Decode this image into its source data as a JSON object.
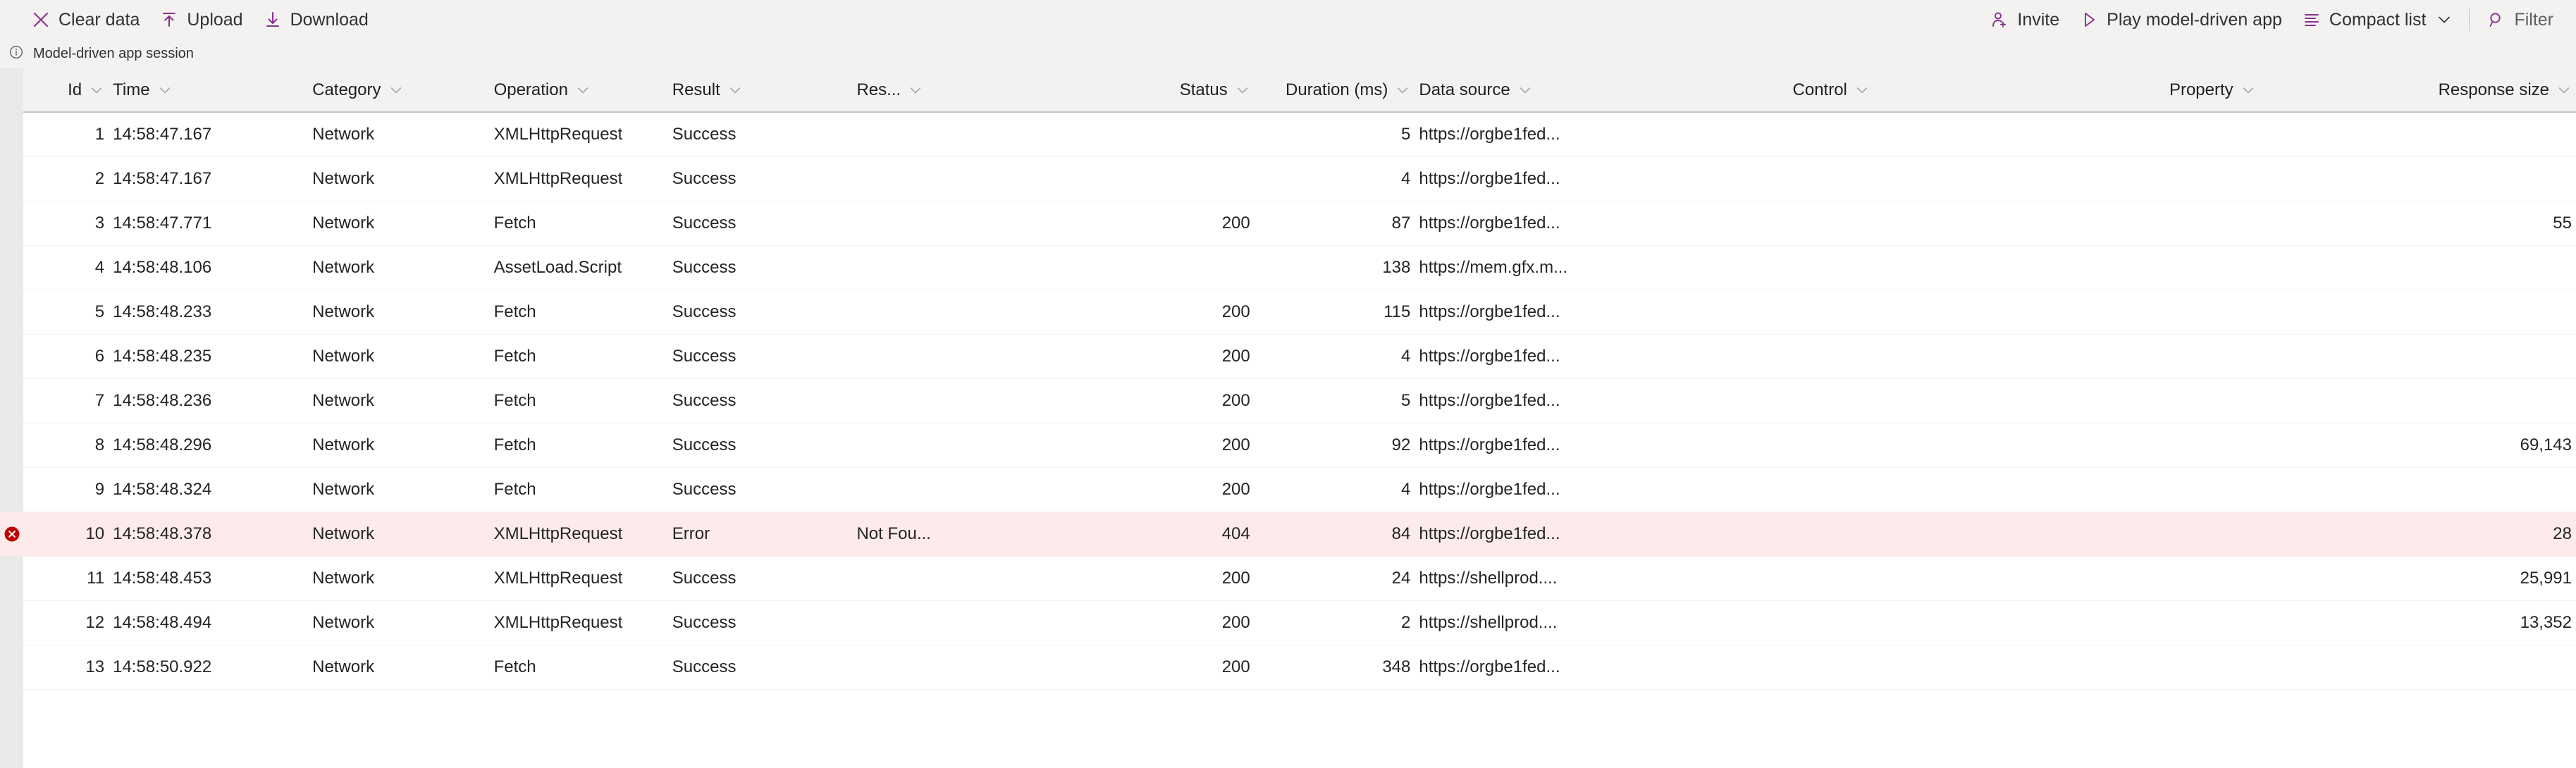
{
  "commandbar": {
    "left_items": [
      {
        "label": "Clear data",
        "icon": "clear-data-icon"
      },
      {
        "label": "Upload",
        "icon": "upload-icon"
      },
      {
        "label": "Download",
        "icon": "download-icon"
      }
    ],
    "right_items": [
      {
        "label": "Invite",
        "icon": "invite-person-add-icon"
      },
      {
        "label": "Play model-driven app",
        "icon": "play-triangle-icon"
      },
      {
        "label": "Compact list",
        "icon": "list-lines-icon",
        "chevron": "∨"
      },
      {
        "label": "Filter",
        "icon": "filter-search-icon"
      }
    ],
    "accent_color": "#8a2f8f"
  },
  "session": {
    "icon": "info-circle-icon",
    "label": "Model-driven app session"
  },
  "grid": {
    "sort_glyph": "∨",
    "columns": [
      {
        "key": "id",
        "label": "Id",
        "align": "right"
      },
      {
        "key": "time",
        "label": "Time",
        "align": "left"
      },
      {
        "key": "category",
        "label": "Category",
        "align": "left"
      },
      {
        "key": "operation",
        "label": "Operation",
        "align": "left"
      },
      {
        "key": "result",
        "label": "Result",
        "align": "left"
      },
      {
        "key": "res",
        "label": "Res...",
        "align": "left"
      },
      {
        "key": "status",
        "label": "Status",
        "align": "right"
      },
      {
        "key": "duration",
        "label": "Duration (ms)",
        "align": "right"
      },
      {
        "key": "source",
        "label": "Data source",
        "align": "left"
      },
      {
        "key": "control",
        "label": "Control",
        "align": "left"
      },
      {
        "key": "property",
        "label": "Property",
        "align": "left"
      },
      {
        "key": "respsize",
        "label": "Response size",
        "align": "right"
      }
    ],
    "error_icon": "error-circle-x-icon",
    "error_row_color": "#fdeaea",
    "rows": [
      {
        "id": "1",
        "time": "14:58:47.167",
        "category": "Network",
        "operation": "XMLHttpRequest",
        "result": "Success",
        "res": "",
        "status": "",
        "duration": "5",
        "source": "https://orgbe1fed...",
        "control": "",
        "property": "",
        "respsize": "",
        "error": false
      },
      {
        "id": "2",
        "time": "14:58:47.167",
        "category": "Network",
        "operation": "XMLHttpRequest",
        "result": "Success",
        "res": "",
        "status": "",
        "duration": "4",
        "source": "https://orgbe1fed...",
        "control": "",
        "property": "",
        "respsize": "",
        "error": false
      },
      {
        "id": "3",
        "time": "14:58:47.771",
        "category": "Network",
        "operation": "Fetch",
        "result": "Success",
        "res": "",
        "status": "200",
        "duration": "87",
        "source": "https://orgbe1fed...",
        "control": "",
        "property": "",
        "respsize": "55",
        "error": false
      },
      {
        "id": "4",
        "time": "14:58:48.106",
        "category": "Network",
        "operation": "AssetLoad.Script",
        "result": "Success",
        "res": "",
        "status": "",
        "duration": "138",
        "source": "https://mem.gfx.m...",
        "control": "",
        "property": "",
        "respsize": "",
        "error": false
      },
      {
        "id": "5",
        "time": "14:58:48.233",
        "category": "Network",
        "operation": "Fetch",
        "result": "Success",
        "res": "",
        "status": "200",
        "duration": "115",
        "source": "https://orgbe1fed...",
        "control": "",
        "property": "",
        "respsize": "",
        "error": false
      },
      {
        "id": "6",
        "time": "14:58:48.235",
        "category": "Network",
        "operation": "Fetch",
        "result": "Success",
        "res": "",
        "status": "200",
        "duration": "4",
        "source": "https://orgbe1fed...",
        "control": "",
        "property": "",
        "respsize": "",
        "error": false
      },
      {
        "id": "7",
        "time": "14:58:48.236",
        "category": "Network",
        "operation": "Fetch",
        "result": "Success",
        "res": "",
        "status": "200",
        "duration": "5",
        "source": "https://orgbe1fed...",
        "control": "",
        "property": "",
        "respsize": "",
        "error": false
      },
      {
        "id": "8",
        "time": "14:58:48.296",
        "category": "Network",
        "operation": "Fetch",
        "result": "Success",
        "res": "",
        "status": "200",
        "duration": "92",
        "source": "https://orgbe1fed...",
        "control": "",
        "property": "",
        "respsize": "69,143",
        "error": false
      },
      {
        "id": "9",
        "time": "14:58:48.324",
        "category": "Network",
        "operation": "Fetch",
        "result": "Success",
        "res": "",
        "status": "200",
        "duration": "4",
        "source": "https://orgbe1fed...",
        "control": "",
        "property": "",
        "respsize": "",
        "error": false
      },
      {
        "id": "10",
        "time": "14:58:48.378",
        "category": "Network",
        "operation": "XMLHttpRequest",
        "result": "Error",
        "res": "Not Fou...",
        "status": "404",
        "duration": "84",
        "source": "https://orgbe1fed...",
        "control": "",
        "property": "",
        "respsize": "28",
        "error": true
      },
      {
        "id": "11",
        "time": "14:58:48.453",
        "category": "Network",
        "operation": "XMLHttpRequest",
        "result": "Success",
        "res": "",
        "status": "200",
        "duration": "24",
        "source": "https://shellprod....",
        "control": "",
        "property": "",
        "respsize": "25,991",
        "error": false
      },
      {
        "id": "12",
        "time": "14:58:48.494",
        "category": "Network",
        "operation": "XMLHttpRequest",
        "result": "Success",
        "res": "",
        "status": "200",
        "duration": "2",
        "source": "https://shellprod....",
        "control": "",
        "property": "",
        "respsize": "13,352",
        "error": false
      },
      {
        "id": "13",
        "time": "14:58:50.922",
        "category": "Network",
        "operation": "Fetch",
        "result": "Success",
        "res": "",
        "status": "200",
        "duration": "348",
        "source": "https://orgbe1fed...",
        "control": "",
        "property": "",
        "respsize": "",
        "error": false
      }
    ]
  }
}
